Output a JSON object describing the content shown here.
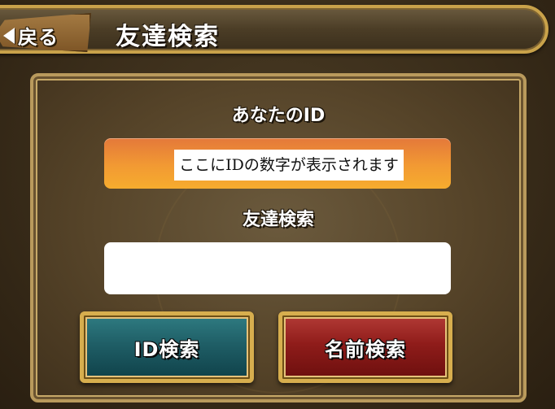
{
  "header": {
    "back_label": "戻る",
    "title": "友達検索"
  },
  "panel": {
    "id_label": "あなたのID",
    "id_value": "ここにIDの数字が表示されます",
    "search_label": "友達検索",
    "search_value": "",
    "search_placeholder": ""
  },
  "buttons": {
    "id_search": "ID検索",
    "name_search": "名前検索"
  },
  "colors": {
    "frame_gold": "#c9a24a",
    "id_button": "#1f5e66",
    "name_button": "#8f1c1a",
    "id_display": "#f29a33"
  },
  "icons": {
    "back": "back-arrow-icon"
  }
}
